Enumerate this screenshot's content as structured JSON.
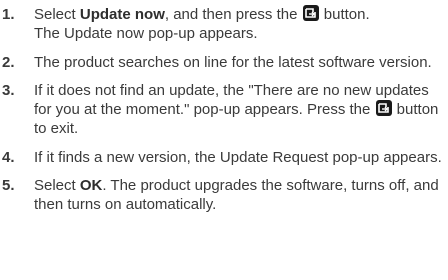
{
  "steps": [
    {
      "number": "1.",
      "pre": "Select ",
      "bold": "Update now",
      "mid": ", and then press the ",
      "post": " button.",
      "line2": "The Update now pop-up appears."
    },
    {
      "number": "2.",
      "text": "The product searches on line for the latest software version."
    },
    {
      "number": "3.",
      "text_a": "If it does not find an update, the \"There are no new updates for you at the moment.\" pop-up appears. Press the ",
      "text_b": " button to exit."
    },
    {
      "number": "4.",
      "text": "If it finds a new version, the Update Request pop-up appears."
    },
    {
      "number": "5.",
      "pre": "Select ",
      "bold": "OK",
      "post": ". The product upgrades the software, turns off, and then turns on automatically."
    }
  ],
  "icons": {
    "enter_button": "enter-button-icon",
    "color": "#1a1a1a"
  }
}
